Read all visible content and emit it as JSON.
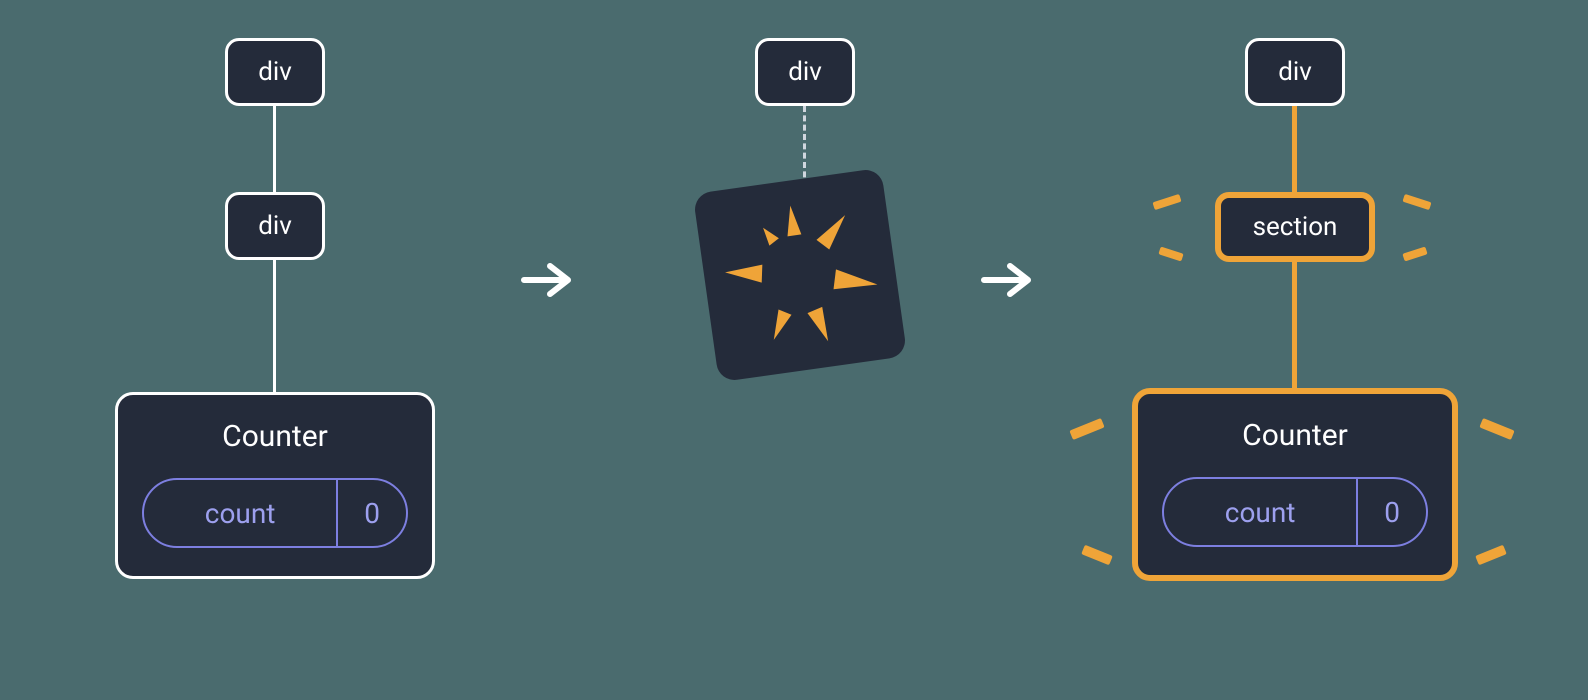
{
  "colors": {
    "bg": "#4a6b6e",
    "node": "#242b3a",
    "border_white": "#ffffff",
    "border_highlight": "#efa438",
    "pill_border": "#7d7fe0",
    "pill_text": "#9da0ee"
  },
  "stage1": {
    "root_label": "div",
    "mid_label": "div",
    "counter_label": "Counter",
    "state_key": "count",
    "state_value": "0"
  },
  "stage2": {
    "root_label": "div"
  },
  "stage3": {
    "root_label": "div",
    "mid_label": "section",
    "counter_label": "Counter",
    "state_key": "count",
    "state_value": "0"
  },
  "diagram": {
    "description": "Three-stage component tree diagram showing state reset when parent element type changes from div to section"
  }
}
